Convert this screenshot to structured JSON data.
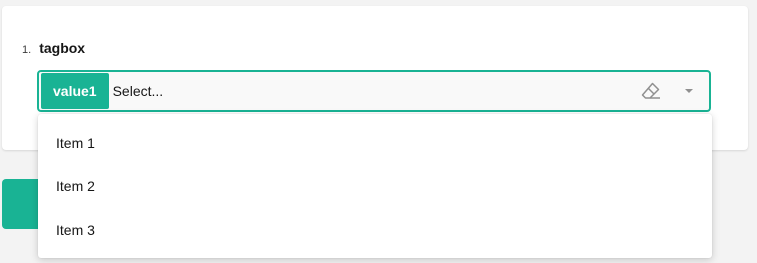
{
  "question": {
    "number": "1.",
    "title": "tagbox"
  },
  "tagbox": {
    "selected_tag": "value1",
    "placeholder": "Select...",
    "clear_icon": "eraser-icon",
    "dropdown_icon": "chevron-down-icon"
  },
  "dropdown": {
    "items": [
      {
        "label": "Item 1"
      },
      {
        "label": "Item 2"
      },
      {
        "label": "Item 3"
      }
    ]
  },
  "colors": {
    "accent": "#19b394",
    "background": "#f3f3f3",
    "panel": "#ffffff"
  }
}
